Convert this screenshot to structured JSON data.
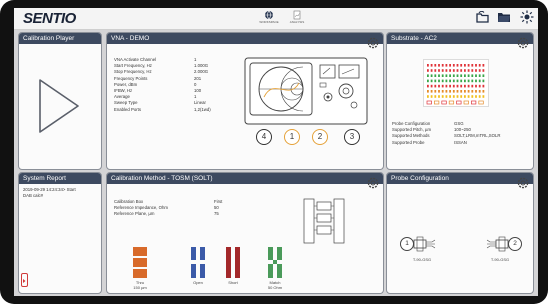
{
  "brand": {
    "logo": "SENTIO"
  },
  "topbar": {
    "center_items": [
      {
        "label": "WORKSPACE",
        "icon": "globe-icon"
      },
      {
        "label": "ANALYSIS",
        "icon": "document-chart-icon"
      }
    ],
    "right_icons": [
      "open-folder-icon",
      "folder-icon",
      "settings-sun-icon"
    ]
  },
  "panels": {
    "calibration_player": {
      "title": "Calibration Player"
    },
    "vna": {
      "title": "VNA - DEMO",
      "params": [
        {
          "key": "VNA Activate Channel",
          "value": "1"
        },
        {
          "key": "Start Frequency, Hz",
          "value": "1.000G"
        },
        {
          "key": "Stop Frequency, Hz",
          "value": "2.000G"
        },
        {
          "key": "Frequency Points",
          "value": "201"
        },
        {
          "key": "Power, dBm",
          "value": "0"
        },
        {
          "key": "IFBW, Hz",
          "value": "100"
        },
        {
          "key": "Average",
          "value": "1"
        },
        {
          "key": "Sweep Type",
          "value": "Linear"
        },
        {
          "key": "Enabled Ports",
          "value": "1,2(1wd)"
        }
      ],
      "ports": [
        "4",
        "1",
        "2",
        "3"
      ]
    },
    "substrate": {
      "title": "Substrate - AC2",
      "params": [
        {
          "key": "Probe Configuration",
          "value": "GSG"
        },
        {
          "key": "Supported Pitch, µm",
          "value": "100~250"
        },
        {
          "key": "Supported Methods",
          "value": "SOLT,LRM,mTRL,SOLR"
        },
        {
          "key": "Supported Probe",
          "value": "ISSAN"
        }
      ],
      "colors": {
        "red": "#e0343a",
        "green": "#3aa64a",
        "orange": "#e58b2a",
        "yellow": "#f2c01e"
      }
    },
    "system_report": {
      "title": "System Report",
      "log": [
        "2019-09-29 14:24:34> Start",
        "DAB calc#"
      ]
    },
    "calibration_method": {
      "title": "Calibration Method - TOSM (SOLT)",
      "params": [
        {
          "key": "Calibration Box",
          "value": "First"
        },
        {
          "key": "Reference Impedance, Ohm",
          "value": "50"
        },
        {
          "key": "Reference Plane, µm",
          "value": "75"
        }
      ],
      "standards": [
        {
          "name": "Thru",
          "detail": "150 µm",
          "color": "#d86a2a"
        },
        {
          "name": "Open",
          "detail": "",
          "color": "#3b5aa8"
        },
        {
          "name": "Short",
          "detail": "",
          "color": "#a3282a"
        },
        {
          "name": "Match",
          "detail": "50 Ohm",
          "color": "#4a9a5a"
        }
      ]
    },
    "probe_config": {
      "title": "Probe Configuration",
      "probes": [
        {
          "label": "T-90-GSG",
          "port": "1"
        },
        {
          "label": "T-90-GSG",
          "port": "2"
        }
      ]
    }
  }
}
